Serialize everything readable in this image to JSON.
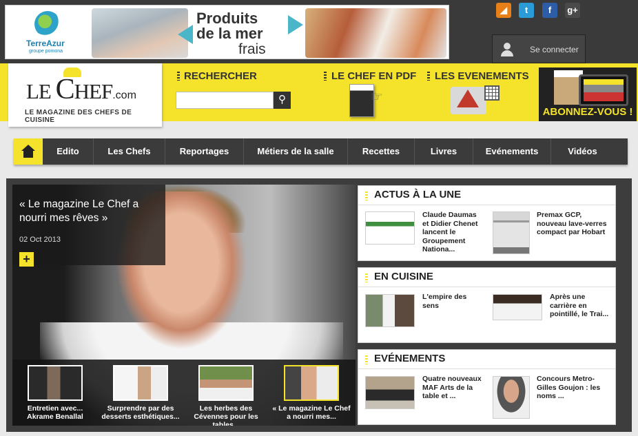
{
  "ad": {
    "brand": "TerreAzur",
    "brand_sub": "groupe pomona",
    "headline_line1": "Produits",
    "headline_line2": "de la mer",
    "headline_line3": "frais"
  },
  "social": [
    {
      "name": "rss",
      "glyph": "◢",
      "color": "#e8801a"
    },
    {
      "name": "twitter",
      "glyph": "t",
      "color": "#2b9bd8"
    },
    {
      "name": "facebook",
      "glyph": "f",
      "color": "#2d5da6"
    },
    {
      "name": "googleplus",
      "glyph": "g+",
      "color": "#4a4a4a"
    }
  ],
  "login": {
    "label": "Se connecter"
  },
  "header": {
    "logo_le": "LE ",
    "logo_c": "C",
    "logo_hef": "HEF",
    "logo_com": ".com",
    "tagline": "LE MAGAZINE DES CHEFS DE CUISINE",
    "search_title": "RECHERCHER",
    "search_placeholder": "",
    "pdf_title": "LE CHEF EN PDF",
    "events_title": "LES EVENEMENTS",
    "subscribe_label": "ABONNEZ-VOUS !"
  },
  "nav": {
    "items": [
      "Edito",
      "Les Chefs",
      "Reportages",
      "Métiers de la salle",
      "Recettes",
      "Livres",
      "Evénements",
      "Vidéos"
    ]
  },
  "feature": {
    "title": "« Le magazine Le Chef a nourri mes rêves »",
    "date": "02 Oct 2013",
    "plus": "+",
    "thumbs": [
      {
        "caption": "Entretien avec... Akrame Benallal"
      },
      {
        "caption": "Surprendre par des desserts esthétiques..."
      },
      {
        "caption": "Les herbes des Cévennes pour les tables..."
      },
      {
        "caption": "« Le magazine Le Chef a nourri mes..."
      }
    ]
  },
  "panels": {
    "actus": {
      "title": "ACTUS À LA UNE",
      "items": [
        {
          "text": "Claude Daumas et Didier Chenet lancent le Groupement Nationa..."
        },
        {
          "text": "Premax GCP, nouveau lave-verres compact par Hobart"
        }
      ]
    },
    "cuisine": {
      "title": "EN CUISINE",
      "items": [
        {
          "text": "L'empire des sens"
        },
        {
          "text": "Après une carrière en pointillé, le Trai..."
        }
      ]
    },
    "evenements": {
      "title": "EVÉNEMENTS",
      "items": [
        {
          "text": "Quatre nouveaux MAF Arts de la table et ..."
        },
        {
          "text": "Concours Metro-Gilles Goujon : les noms ..."
        }
      ]
    }
  },
  "colors": {
    "accent": "#f4e32a",
    "dark": "#3b3b3b"
  }
}
